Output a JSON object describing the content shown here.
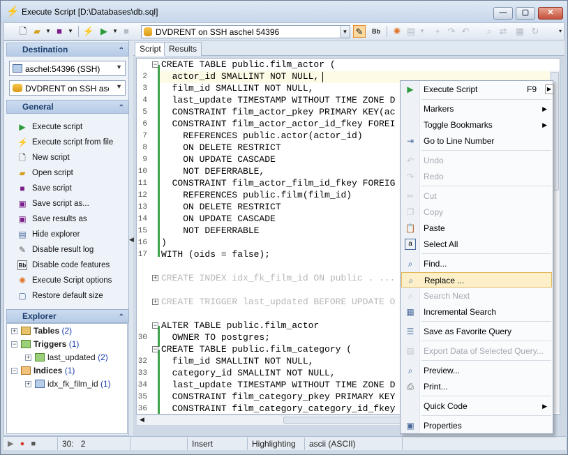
{
  "window": {
    "title": "Execute Script [D:\\Databases\\db.sql]",
    "title_icon": "lightning-icon"
  },
  "toolbar": {
    "connection": "DVDRENT on SSH aschel 54396"
  },
  "left": {
    "destination_label": "Destination",
    "host_combo": "aschel:54396 (SSH)",
    "db_combo": "DVDRENT on SSH aschel 54396",
    "general_label": "General",
    "actions": [
      {
        "label": "Execute script",
        "icon": "play-icon"
      },
      {
        "label": "Execute script from file",
        "icon": "lightning-icon"
      },
      {
        "label": "New script",
        "icon": "new-file-icon"
      },
      {
        "label": "Open script",
        "icon": "folder-open-icon"
      },
      {
        "label": "Save script",
        "icon": "save-icon"
      },
      {
        "label": "Save script as...",
        "icon": "save-as-icon"
      },
      {
        "label": "Save results as",
        "icon": "save-results-icon"
      },
      {
        "label": "Hide explorer",
        "icon": "hide-explorer-icon"
      },
      {
        "label": "Disable result log",
        "icon": "result-log-icon"
      },
      {
        "label": "Disable code features",
        "icon": "code-features-icon"
      },
      {
        "label": "Execute Script options",
        "icon": "options-icon"
      },
      {
        "label": "Restore default size",
        "icon": "restore-size-icon"
      }
    ],
    "explorer_label": "Explorer",
    "tree": [
      {
        "label": "Tables",
        "count": "(2)"
      },
      {
        "label": "Triggers",
        "count": "(1)"
      },
      {
        "label": "last_updated",
        "count": "(2)"
      },
      {
        "label": "Indices",
        "count": "(1)"
      },
      {
        "label": "idx_fk_film_id",
        "count": "(1)"
      }
    ]
  },
  "tabs": [
    "Script",
    "Results"
  ],
  "editor": {
    "lines": [
      {
        "n": "",
        "text": "CREATE TABLE public.film_actor ("
      },
      {
        "n": "2",
        "text": "  actor_id SMALLINT NOT NULL,"
      },
      {
        "n": "3",
        "text": "  film_id SMALLINT NOT NULL,"
      },
      {
        "n": "4",
        "text": "  last_update TIMESTAMP WITHOUT TIME ZONE D"
      },
      {
        "n": "5",
        "text": "  CONSTRAINT film_actor_pkey PRIMARY KEY(ac"
      },
      {
        "n": "6",
        "text": "  CONSTRAINT film_actor_actor_id_fkey FOREI"
      },
      {
        "n": "7",
        "text": "    REFERENCES public.actor(actor_id)"
      },
      {
        "n": "8",
        "text": "    ON DELETE RESTRICT"
      },
      {
        "n": "9",
        "text": "    ON UPDATE CASCADE"
      },
      {
        "n": "10",
        "text": "    NOT DEFERRABLE,"
      },
      {
        "n": "11",
        "text": "  CONSTRAINT film_actor_film_id_fkey FOREIG"
      },
      {
        "n": "12",
        "text": "    REFERENCES public.film(film_id)"
      },
      {
        "n": "13",
        "text": "    ON DELETE RESTRICT"
      },
      {
        "n": "14",
        "text": "    ON UPDATE CASCADE"
      },
      {
        "n": "15",
        "text": "    NOT DEFERRABLE"
      },
      {
        "n": "16",
        "text": ")"
      },
      {
        "n": "17",
        "text": "WITH (oids = false);"
      },
      {
        "n": "",
        "text": "CREATE INDEX idx_fk_film_id ON public . ..."
      },
      {
        "n": "",
        "text": "CREATE TRIGGER last_updated BEFORE UPDATE O"
      },
      {
        "n": "",
        "text": "ALTER TABLE public.film_actor"
      },
      {
        "n": "30",
        "text": "  OWNER TO postgres;"
      },
      {
        "n": "",
        "text": "CREATE TABLE public.film_category ("
      },
      {
        "n": "32",
        "text": "  film_id SMALLINT NOT NULL,"
      },
      {
        "n": "33",
        "text": "  category_id SMALLINT NOT NULL,"
      },
      {
        "n": "34",
        "text": "  last_update TIMESTAMP WITHOUT TIME ZONE D"
      },
      {
        "n": "35",
        "text": "  CONSTRAINT film_category_pkey PRIMARY KEY"
      },
      {
        "n": "36",
        "text": "  CONSTRAINT film_category_category_id_fkey"
      }
    ]
  },
  "status": {
    "position_line": "30:",
    "position_col": "2",
    "mode": "Insert",
    "highlighting": "Highlighting",
    "encoding": "ascii (ASCII)"
  },
  "context_menu": [
    {
      "label": "Execute Script",
      "shortcut": "F9",
      "icon": "play-icon",
      "enabled": true,
      "submenu": false
    },
    {
      "label": "Markers",
      "shortcut": "",
      "icon": "",
      "enabled": true,
      "submenu": true
    },
    {
      "label": "Toggle Bookmarks",
      "shortcut": "",
      "icon": "",
      "enabled": true,
      "submenu": true
    },
    {
      "label": "Go to Line Number",
      "shortcut": "",
      "icon": "goto-line-icon",
      "enabled": true,
      "submenu": false
    },
    {
      "label": "Undo",
      "shortcut": "",
      "icon": "undo-icon",
      "enabled": false,
      "submenu": false
    },
    {
      "label": "Redo",
      "shortcut": "",
      "icon": "redo-icon",
      "enabled": false,
      "submenu": false
    },
    {
      "label": "Cut",
      "shortcut": "",
      "icon": "cut-icon",
      "enabled": false,
      "submenu": false
    },
    {
      "label": "Copy",
      "shortcut": "",
      "icon": "copy-icon",
      "enabled": false,
      "submenu": false
    },
    {
      "label": "Paste",
      "shortcut": "",
      "icon": "paste-icon",
      "enabled": true,
      "submenu": false
    },
    {
      "label": "Select All",
      "shortcut": "",
      "icon": "select-all-icon",
      "enabled": true,
      "submenu": false
    },
    {
      "label": "Find...",
      "shortcut": "",
      "icon": "find-icon",
      "enabled": true,
      "submenu": false
    },
    {
      "label": "Replace ...",
      "shortcut": "",
      "icon": "replace-icon",
      "enabled": true,
      "submenu": false
    },
    {
      "label": "Search Next",
      "shortcut": "",
      "icon": "search-next-icon",
      "enabled": false,
      "submenu": false
    },
    {
      "label": "Incremental Search",
      "shortcut": "",
      "icon": "incremental-search-icon",
      "enabled": true,
      "submenu": false
    },
    {
      "label": "Save as Favorite Query",
      "shortcut": "",
      "icon": "favorite-query-icon",
      "enabled": true,
      "submenu": false
    },
    {
      "label": "Export Data of Selected Query...",
      "shortcut": "",
      "icon": "export-data-icon",
      "enabled": false,
      "submenu": false
    },
    {
      "label": "Preview...",
      "shortcut": "",
      "icon": "preview-icon",
      "enabled": true,
      "submenu": false
    },
    {
      "label": "Print...",
      "shortcut": "",
      "icon": "print-icon",
      "enabled": true,
      "submenu": false
    },
    {
      "label": "Quick Code",
      "shortcut": "",
      "icon": "",
      "enabled": true,
      "submenu": true
    },
    {
      "label": "Properties",
      "shortcut": "",
      "icon": "properties-icon",
      "enabled": true,
      "submenu": false
    }
  ],
  "colors": {
    "accent": "#1c3e6e",
    "fold_bar": "#3fa34d",
    "identifier": "#1b7a8a",
    "menu_hover": "#fdf0c8"
  }
}
